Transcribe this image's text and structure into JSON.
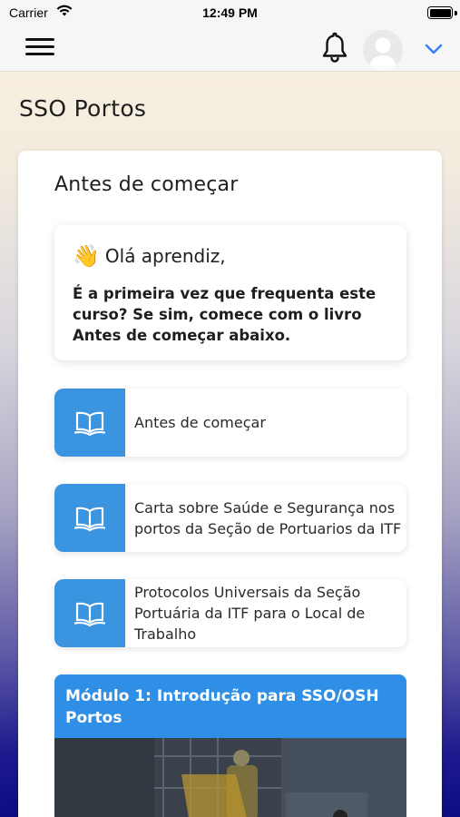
{
  "status_bar": {
    "carrier": "Carrier",
    "time": "12:49 PM"
  },
  "nav": {
    "menu_icon": "hamburger-icon",
    "notification_icon": "bell-icon",
    "avatar_icon": "user-avatar",
    "dropdown_icon": "chevron-down-icon",
    "accent": "#3b82f6"
  },
  "page": {
    "title": "SSO Portos"
  },
  "section": {
    "title": "Antes de começar",
    "greeting_emoji": "👋",
    "greeting": "Olá aprendiz,",
    "message": "É a primeira vez que frequenta este curso? Se sim, comece com o livro Antes de começar abaixo."
  },
  "books": [
    {
      "label": "Antes de começar",
      "icon": "book-open-icon"
    },
    {
      "label": "Carta sobre Saúde e Segurança nos portos da Seção de Portuarios da ITF",
      "icon": "book-open-icon"
    },
    {
      "label": "Protocolos Universais da Seção Portuária da ITF para o Local de Trabalho",
      "icon": "book-open-icon"
    }
  ],
  "module": {
    "title": "Módulo 1: Introdução para SSO/OSH Portos"
  },
  "colors": {
    "book_icon_bg": "#3b94e0",
    "module_header_bg": "#2f8ee6"
  }
}
